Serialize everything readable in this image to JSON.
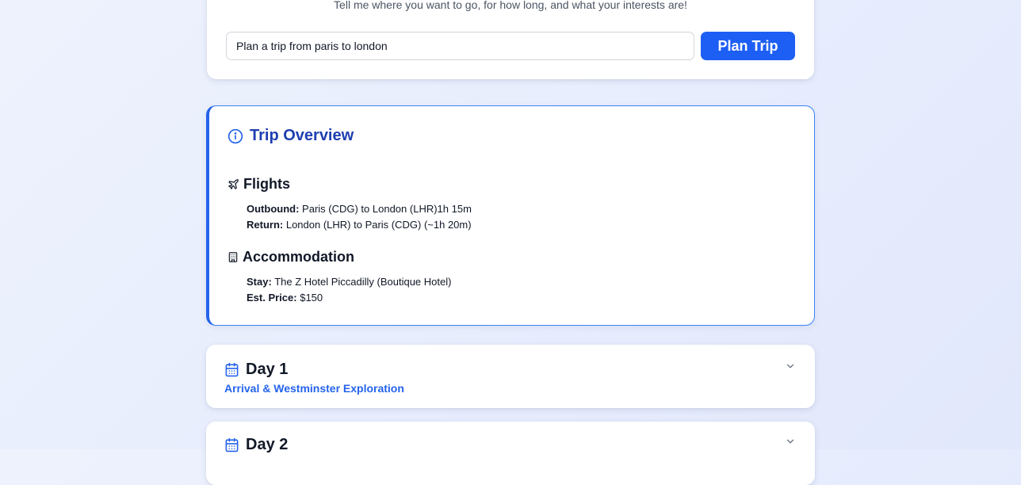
{
  "planner": {
    "subtitle": "Tell me where you want to go, for how long, and what your interests are!",
    "input_value": "Plan a trip from paris to london",
    "button_label": "Plan Trip"
  },
  "overview": {
    "title": "Trip Overview",
    "title_icon": "info-icon",
    "flights": {
      "heading": "Flights",
      "icon": "plane-icon",
      "outbound_label": "Outbound:",
      "outbound_value": "Paris (CDG) to London (LHR)1h 15m",
      "return_label": "Return:",
      "return_value": "London (LHR) to Paris (CDG) (~1h 20m)"
    },
    "accommodation": {
      "heading": "Accommodation",
      "icon": "building-icon",
      "stay_label": "Stay:",
      "stay_value": "The Z Hotel Piccadilly (Boutique Hotel)",
      "price_label": "Est. Price:",
      "price_value": "$150"
    }
  },
  "days": [
    {
      "title": "Day 1",
      "subtitle": "Arrival & Westminster Exploration"
    },
    {
      "title": "Day 2",
      "subtitle": ""
    }
  ],
  "colors": {
    "accent": "#1d5ff5",
    "title_blue": "#1e3fb0",
    "link_blue": "#2563eb",
    "card_border": "#3b82f6"
  }
}
